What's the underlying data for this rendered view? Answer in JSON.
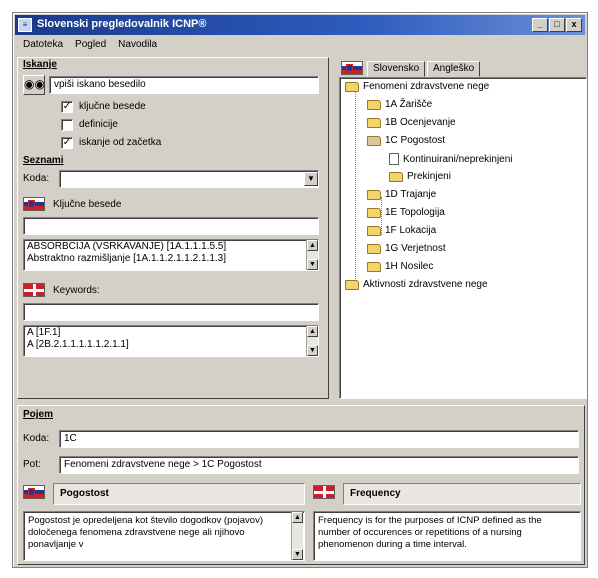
{
  "window": {
    "title": "Slovenski pregledovalnik ICNP®",
    "buttons": {
      "minimize": "_",
      "maximize": "□",
      "close": "x"
    }
  },
  "menu": [
    "Datoteka",
    "Pogled",
    "Navodila"
  ],
  "iskanje": {
    "section_label": "Iskanje",
    "search_value": "vpiši iskano besedilo",
    "options": [
      {
        "label": "ključne besede",
        "checked": true
      },
      {
        "label": "definicije",
        "checked": false
      },
      {
        "label": "iskanje od začetka",
        "checked": true
      }
    ]
  },
  "seznami": {
    "section_label": "Seznami",
    "koda_label": "Koda:",
    "koda_value": "",
    "slovenian_list": {
      "label": "Ključne besede",
      "filter_value": "",
      "items": [
        "ABSORBCIJA (VSRKAVANJE) [1A.1.1.1.5.5]",
        "Abstraktno razmišljanje [1A.1.1.2.1.1.2.1.1.3]"
      ]
    },
    "english_list": {
      "label": "Keywords:",
      "filter_value": "",
      "items": [
        "A [1F.1]",
        "A [2B.2.1.1.1.1.1.2.1.1]"
      ]
    }
  },
  "tabs": [
    "Slovensko",
    "Angleško"
  ],
  "tree": [
    {
      "label": "Fenomeni zdravstvene nege",
      "icon": "folder-open-icon"
    },
    {
      "label": "1A Žarišče",
      "icon": "folder-icon"
    },
    {
      "label": "1B Ocenjevanje",
      "icon": "folder-icon"
    },
    {
      "label": "1C Pogostost",
      "icon": "folder-open-icon"
    },
    {
      "label": "Kontinuirani/neprekinjeni",
      "icon": "document-icon"
    },
    {
      "label": "Prekinjeni",
      "icon": "folder-icon"
    },
    {
      "label": "1D Trajanje",
      "icon": "folder-icon"
    },
    {
      "label": "1E Topologija",
      "icon": "folder-icon"
    },
    {
      "label": "1F Lokacija",
      "icon": "folder-icon"
    },
    {
      "label": "1G Verjetnost",
      "icon": "folder-icon"
    },
    {
      "label": "1H Nosilec",
      "icon": "folder-icon"
    },
    {
      "label": "Aktivnosti zdravstvene nege",
      "icon": "folder-icon"
    }
  ],
  "pojem": {
    "section_label": "Pojem",
    "koda_label": "Koda:",
    "koda_value": "1C",
    "pot_label": "Pot:",
    "pot_value": "Fenomeni zdravstvene nege > 1C Pogostost",
    "slovenian": {
      "term": "Pogostost",
      "definition": "Pogostost je opredeljena kot število dogodkov (pojavov) določenega fenomena zdravstvene nege ali njihovo ponavljanje v"
    },
    "english": {
      "term": "Frequency",
      "definition": "Frequency is for the purposes of ICNP defined as the number of occurences or repetitions of a nursing phenomenon during a time interval."
    }
  }
}
